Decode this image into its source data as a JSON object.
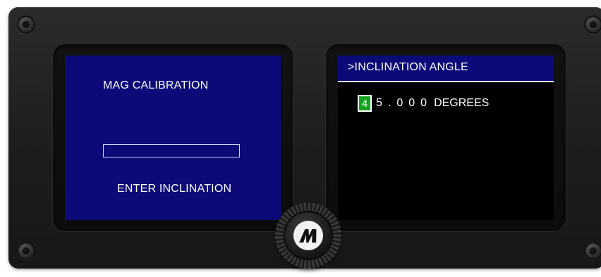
{
  "left_display": {
    "title": "MAG CALIBRATION",
    "progress": 0,
    "prompt": "ENTER INCLINATION"
  },
  "right_display": {
    "header": ">INCLINATION ANGLE",
    "value_digits": [
      "4",
      "5",
      ".",
      "0",
      "0",
      "0"
    ],
    "selected_digit_index": 0,
    "unit": "DEGREES"
  },
  "knob": {
    "icon": "m-logo-icon"
  },
  "colors": {
    "lcd_blue": "#0b0a78",
    "lcd_black": "#000000",
    "cursor_green": "#13a31e"
  }
}
